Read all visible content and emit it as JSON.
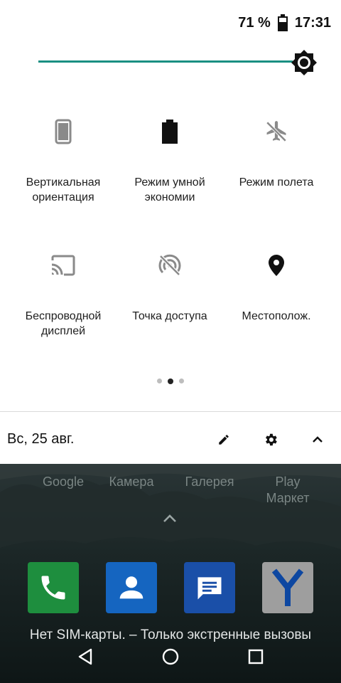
{
  "status_bar": {
    "battery_percent": "71 %",
    "time": "17:31"
  },
  "brightness": {
    "level": 0.93
  },
  "tiles": [
    {
      "label": "Вертикальная\nориентация",
      "icon": "phone-portrait-icon",
      "active": false
    },
    {
      "label": "Режим умной\nэкономии",
      "icon": "battery-saver-icon",
      "active": true
    },
    {
      "label": "Режим полета",
      "icon": "airplane-off-icon",
      "active": false
    },
    {
      "label": "Беспроводной\nдисплей",
      "icon": "cast-icon",
      "active": false
    },
    {
      "label": "Точка доступа",
      "icon": "hotspot-off-icon",
      "active": false
    },
    {
      "label": "Местополож.",
      "icon": "location-pin-icon",
      "active": true
    }
  ],
  "pager": {
    "pages": 3,
    "current": 2
  },
  "footer": {
    "date": "Вс, 25 авг."
  },
  "home": {
    "dock_labels": [
      "Google",
      "Камера",
      "Галерея",
      "Play\nМаркет"
    ],
    "apps": [
      {
        "name": "phone-app-icon",
        "color": "#1e8e3e"
      },
      {
        "name": "contacts-app-icon",
        "color": "#1565c0"
      },
      {
        "name": "messages-app-icon",
        "color": "#1a4fa8"
      },
      {
        "name": "yandex-app-icon",
        "color": "#9e9e9e"
      }
    ],
    "sim_status": "Нет SIM-карты. – Только экстренные вызовы"
  },
  "colors": {
    "accent": "#1a8f82",
    "panel_bg": "#ffffff"
  }
}
